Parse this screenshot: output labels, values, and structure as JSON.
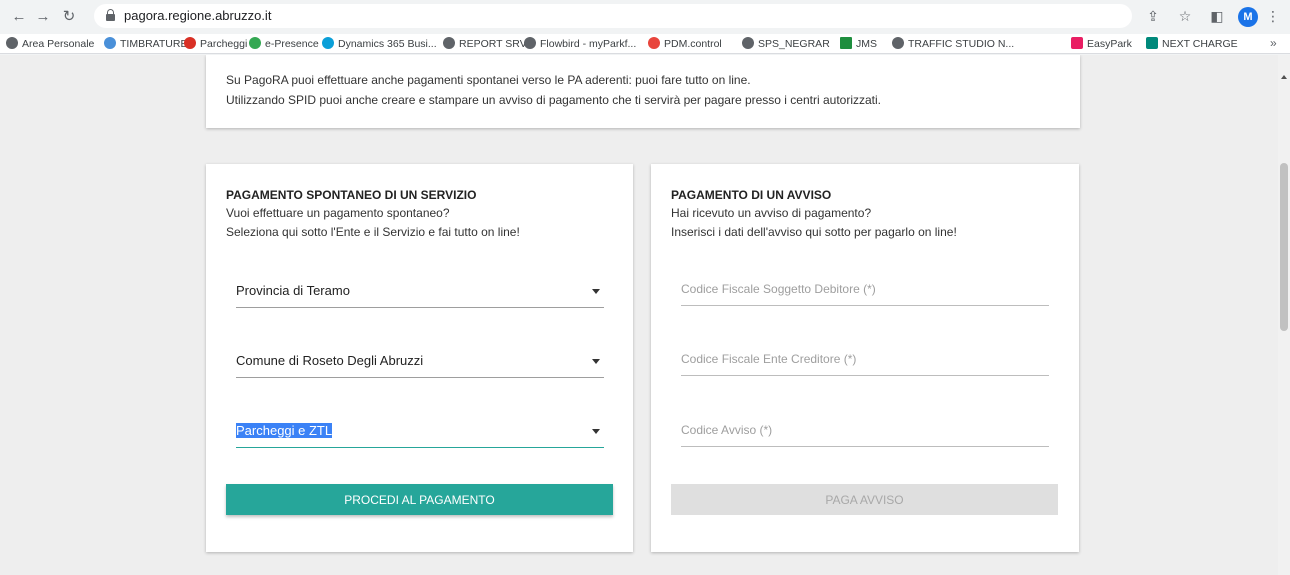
{
  "browser": {
    "url": "pagora.regione.abruzzo.it",
    "avatar_initial": "M",
    "bookmarks": [
      {
        "label": "Area Personale",
        "color": "#5f6368"
      },
      {
        "label": "TIMBRATURE",
        "color": "#4a90d9"
      },
      {
        "label": "Parcheggi",
        "color": "#d93025"
      },
      {
        "label": "e-Presence",
        "color": "#34a853"
      },
      {
        "label": "Dynamics 365 Busi...",
        "color": "#0b9fd8"
      },
      {
        "label": "REPORT SRV",
        "color": "#5f6368"
      },
      {
        "label": "Flowbird - myParkf...",
        "color": "#5f6368"
      },
      {
        "label": "PDM.control",
        "color": "#e8453c"
      },
      {
        "label": "SPS_NEGRAR",
        "color": "#5f6368"
      },
      {
        "label": "JMS",
        "color": "#1e8e3e"
      },
      {
        "label": "TRAFFIC STUDIO N...",
        "color": "#5f6368"
      },
      {
        "label": "EasyPark",
        "color": "#e91e63"
      },
      {
        "label": "NEXT CHARGE",
        "color": "#00897b"
      }
    ]
  },
  "info": {
    "line1": "Su PagoRA puoi effettuare anche pagamenti spontanei verso le PA aderenti: puoi fare tutto on line.",
    "line2": "Utilizzando SPID puoi anche creare e stampare un avviso di pagamento che ti servirà per pagare presso i centri autorizzati."
  },
  "spontaneous": {
    "title": "PAGAMENTO SPONTANEO DI UN SERVIZIO",
    "subtitle1": "Vuoi effettuare un pagamento spontaneo?",
    "subtitle2": "Seleziona qui sotto l'Ente e il Servizio e fai tutto on line!",
    "select_provincia": "Provincia di Teramo",
    "select_comune": "Comune di Roseto Degli Abruzzi",
    "select_servizio": "Parcheggi e ZTL",
    "button": "PROCEDI AL PAGAMENTO",
    "accent_color": "#26a69a"
  },
  "notice": {
    "title": "PAGAMENTO DI UN AVVISO",
    "subtitle1": "Hai ricevuto un avviso di pagamento?",
    "subtitle2": "Inserisci i dati dell'avviso qui sotto per pagarlo on line!",
    "field_cf_debitore": "Codice Fiscale Soggetto Debitore (*)",
    "field_cf_ente": "Codice Fiscale Ente Creditore (*)",
    "field_codice_avviso": "Codice Avviso (*)",
    "button": "PAGA AVVISO"
  }
}
